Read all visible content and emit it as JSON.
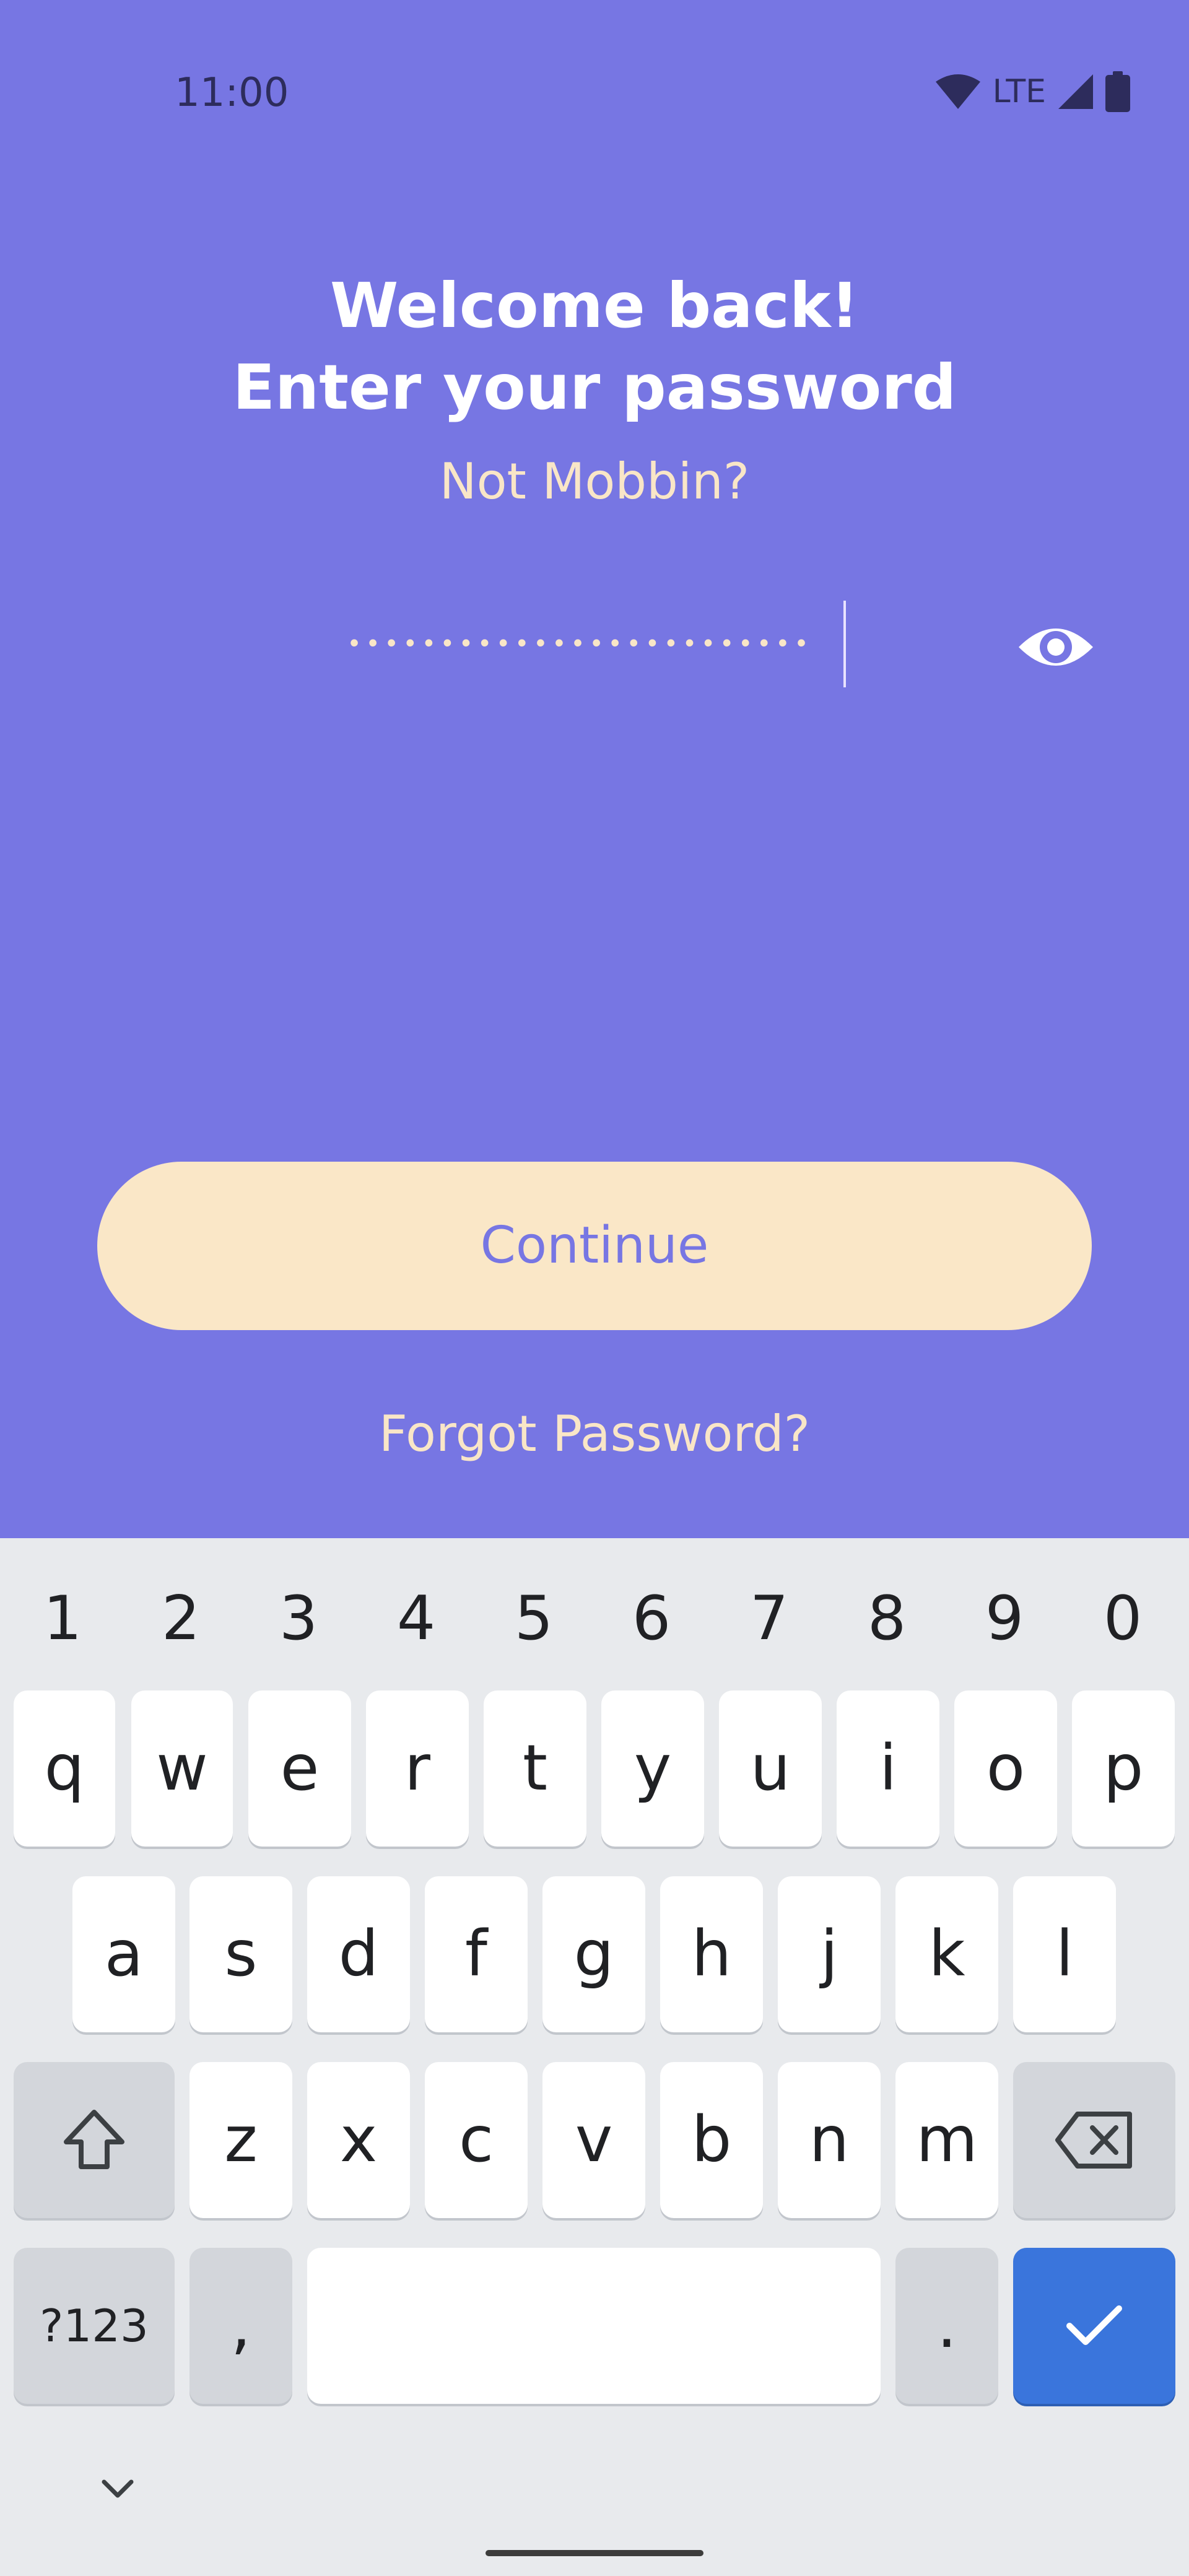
{
  "status_bar": {
    "time": "11:00",
    "network": "LTE"
  },
  "login": {
    "title_line1": "Welcome back!",
    "title_line2": "Enter your password",
    "not_user": "Not Mobbin?",
    "password_mask": "•••••••••••••••••••••••••",
    "continue_label": "Continue",
    "forgot_label": "Forgot Password?"
  },
  "keyboard": {
    "numbers": [
      "1",
      "2",
      "3",
      "4",
      "5",
      "6",
      "7",
      "8",
      "9",
      "0"
    ],
    "row1": [
      "q",
      "w",
      "e",
      "r",
      "t",
      "y",
      "u",
      "i",
      "o",
      "p"
    ],
    "row2": [
      "a",
      "s",
      "d",
      "f",
      "g",
      "h",
      "j",
      "k",
      "l"
    ],
    "row3": [
      "z",
      "x",
      "c",
      "v",
      "b",
      "n",
      "m"
    ],
    "symbols_label": "?123",
    "comma": ",",
    "period": "."
  },
  "colors": {
    "background": "#7776e3",
    "button": "#fae7c7",
    "accent_text": "#f9e6c7",
    "enter_key": "#3a75dc"
  },
  "icons": [
    "wifi-icon",
    "signal-icon",
    "battery-icon",
    "eye-icon",
    "shift-icon",
    "backspace-icon",
    "check-icon",
    "chevron-down-icon"
  ]
}
